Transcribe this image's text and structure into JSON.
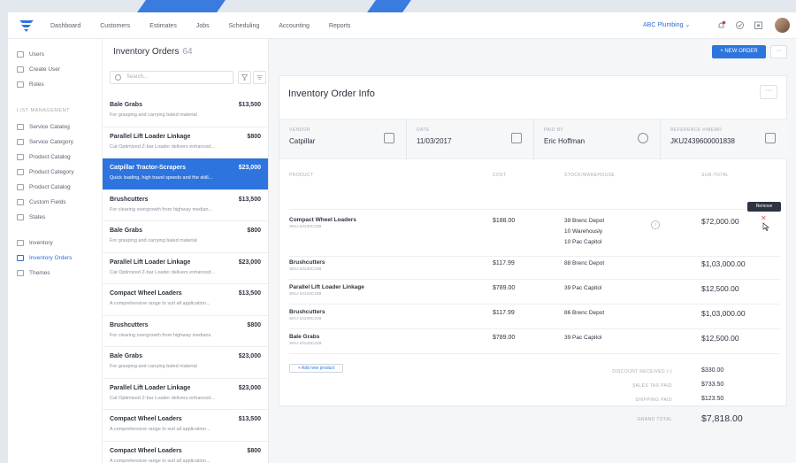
{
  "topnav": {
    "links": [
      "Dashboard",
      "Customers",
      "Estimates",
      "Jobs",
      "Scheduling",
      "Accounting",
      "Reports"
    ],
    "company": "ABC Plumbing ⌄",
    "icons": [
      "notification-icon",
      "check-icon",
      "calendar-icon"
    ]
  },
  "sidebar": {
    "items_top": [
      "Users",
      "Create User",
      "Roles"
    ],
    "section_header": "LIST MANAGEMENT",
    "items_list": [
      "Service Catalog",
      "Service Category",
      "Product Catalog",
      "Product Category",
      "Product Catalog",
      "Custom Fields",
      "States"
    ],
    "items_bottom": [
      "Inventory",
      "Inventory Orders",
      "Themes"
    ],
    "active": "Inventory Orders"
  },
  "list": {
    "title": "Inventory Orders",
    "count": "64",
    "search_placeholder": "Search...",
    "rows": [
      {
        "name": "Bale Grabs",
        "price": "$13,500",
        "desc": "For grasping and carrying baled material",
        "selected": false
      },
      {
        "name": "Parallel Lift Loader Linkage",
        "price": "$800",
        "desc": "Cat Optimized Z-bar Loader delivers enhanced...",
        "selected": false
      },
      {
        "name": "Catpillar Tractor-Scrapers",
        "price": "$23,000",
        "desc": "Quick loading, high travel speeds and the skill...",
        "selected": true
      },
      {
        "name": "Brushcutters",
        "price": "$13,500",
        "desc": "For clearing overgrowth from highway median...",
        "selected": false
      },
      {
        "name": "Bale Grabs",
        "price": "$800",
        "desc": "For grasping and carrying baled material",
        "selected": false
      },
      {
        "name": "Parallel Lift Loader Linkage",
        "price": "$23,000",
        "desc": "Cat Optimized Z-bar Loader delivers enhanced...",
        "selected": false
      },
      {
        "name": "Compact Wheel Loaders",
        "price": "$13,500",
        "desc": "A comprehensive range to suit all application...",
        "selected": false
      },
      {
        "name": "Brushcutters",
        "price": "$800",
        "desc": "For clearing overgrowth from highway medians",
        "selected": false
      },
      {
        "name": "Bale Grabs",
        "price": "$23,000",
        "desc": "For grasping and carrying baled material",
        "selected": false
      },
      {
        "name": "Parallel Lift Loader Linkage",
        "price": "$23,000",
        "desc": "Cat Optimized Z-bar Loader delivers enhanced...",
        "selected": false
      },
      {
        "name": "Compact Wheel Loaders",
        "price": "$13,500",
        "desc": "A comprehensive range to suit all application...",
        "selected": false
      },
      {
        "name": "Compact Wheel Loaders",
        "price": "$800",
        "desc": "A comprehensive range to suit all application...",
        "selected": false
      }
    ]
  },
  "main": {
    "new_order_label": "+ NEW ORDER",
    "more_label": "···",
    "card_title": "Inventory Order Info",
    "info": {
      "vendor_label": "VENDOR",
      "vendor": "Catpillar",
      "date_label": "DATE",
      "date": "11/03/2017",
      "paid_by_label": "PAID BY",
      "paid_by": "Eric Hoffman",
      "ref_label": "REFERENCE #/MEMO",
      "ref": "JKU2439600001838"
    },
    "columns": {
      "product": "PRODUCT",
      "cost": "COST",
      "stock": "STOCK/WAREHOUSE",
      "subtotal": "SUB-TOTAL"
    },
    "products": [
      {
        "name": "Compact Wheel Loaders",
        "sku": "SKU-10120C238",
        "cost": "$188.00",
        "stock": [
          "39 Brenc Depot",
          "10 Warehously",
          "10 Pac Capitol"
        ],
        "total": "$72,000.00"
      },
      {
        "name": "Brushcutters",
        "sku": "SKU-10120C238",
        "cost": "$117.99",
        "stock": [
          "88 Brenc Depot"
        ],
        "total": "$1,03,000.00"
      },
      {
        "name": "Parallel Lift Loader Linkage",
        "sku": "SKU-10120C238",
        "cost": "$789.00",
        "stock": [
          "39 Pac Capitol"
        ],
        "total": "$12,500.00"
      },
      {
        "name": "Brushcutters",
        "sku": "SKU-10120C238",
        "cost": "$117.99",
        "stock": [
          "86 Brenc Depot"
        ],
        "total": "$1,03,000.00"
      },
      {
        "name": "Bale Grabs",
        "sku": "SKU-10120C238",
        "cost": "$789.00",
        "stock": [
          "39 Pac Capitol"
        ],
        "total": "$12,500.00"
      }
    ],
    "tooltip": "Remove",
    "remove_glyph": "✕",
    "add_product_label": "+ Add new product",
    "summary": {
      "discount_label": "DISCOUNT RECEIVED (-)",
      "discount": "$330.00",
      "tax_label": "SALES TAX PAID",
      "tax": "$733.50",
      "shipping_label": "SHIPPING PAID",
      "shipping": "$123.50",
      "grand_label": "GRAND TOTAL",
      "grand": "$7,818.00"
    }
  }
}
